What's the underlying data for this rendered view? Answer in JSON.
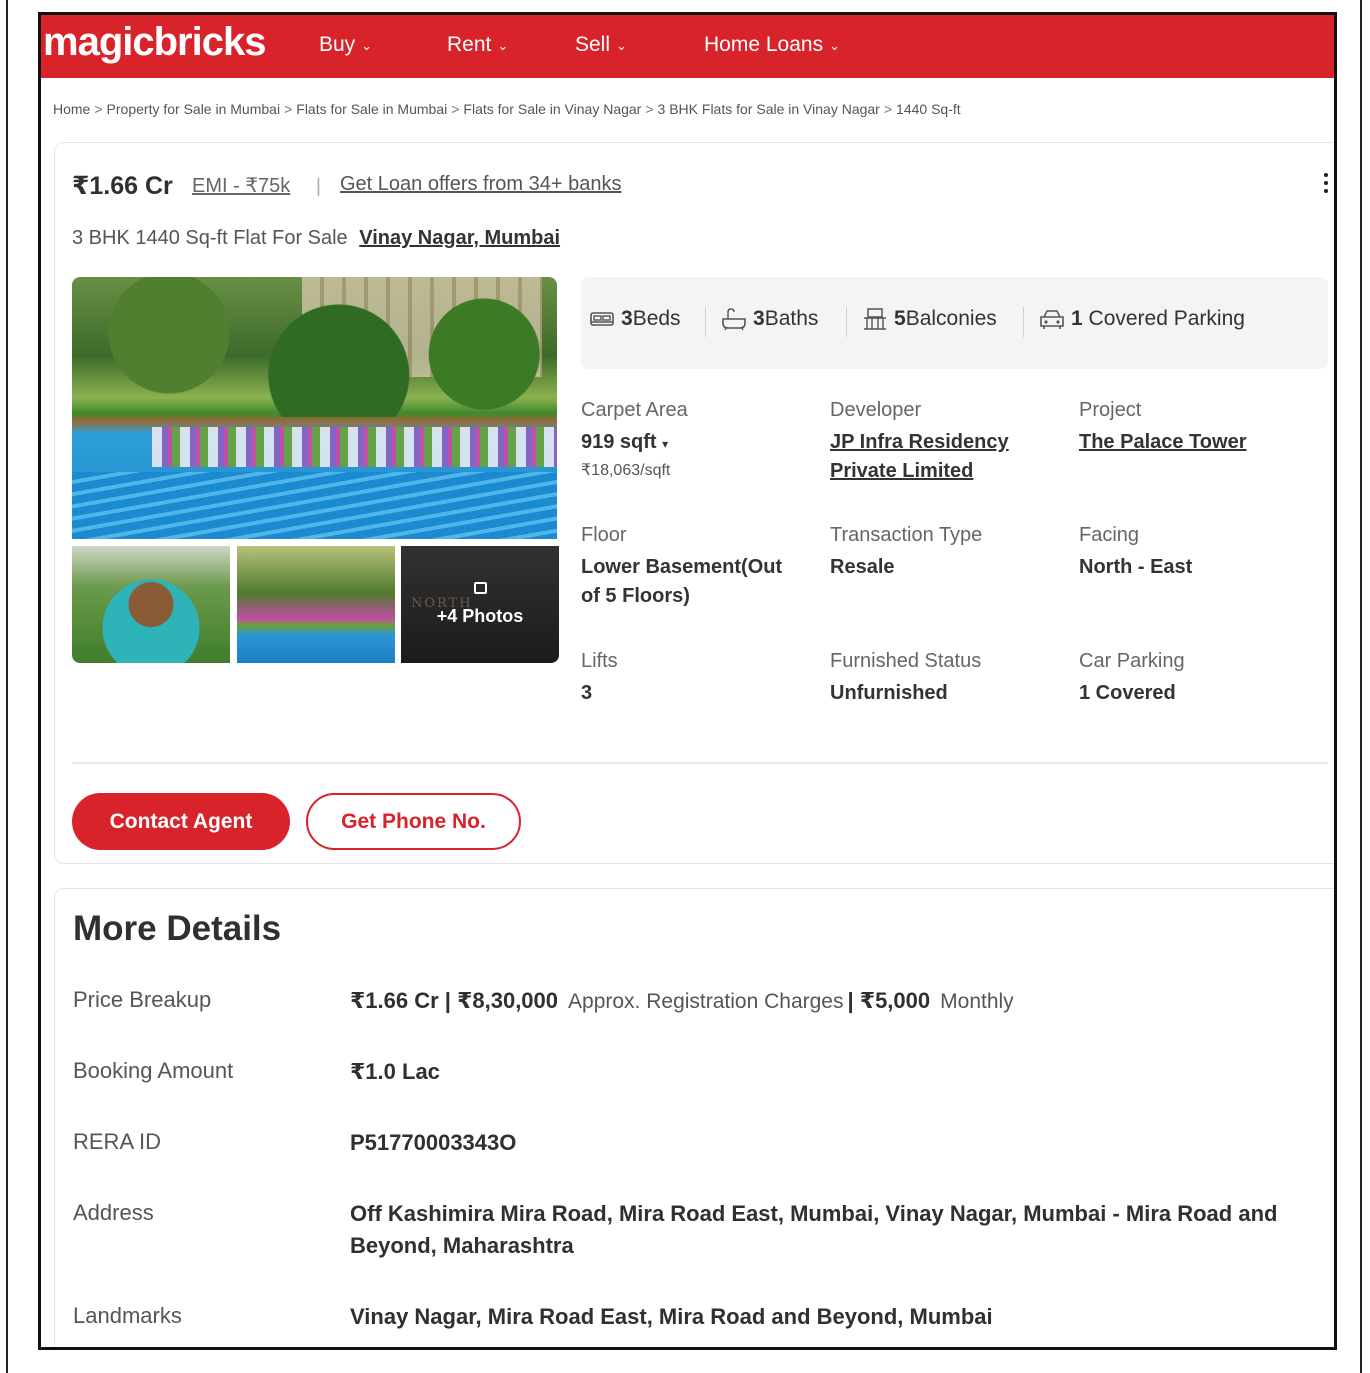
{
  "header": {
    "logo": "magicbricks",
    "nav": [
      {
        "label": "Buy"
      },
      {
        "label": "Rent"
      },
      {
        "label": "Sell"
      },
      {
        "label": "Home Loans"
      }
    ]
  },
  "breadcrumb": [
    "Home",
    "Property for Sale in Mumbai",
    "Flats for Sale in Mumbai",
    "Flats for Sale in Vinay Nagar",
    "3 BHK Flats for Sale in Vinay Nagar",
    "1440 Sq-ft"
  ],
  "listing": {
    "price": "₹1.66 Cr",
    "emi": "EMI - ₹75k",
    "separator": "|",
    "loan_link": "Get Loan offers from 34+ banks",
    "title": "3 BHK 1440 Sq-ft Flat For Sale",
    "locality": "Vinay Nagar, Mumbai",
    "photos_more": "+4 Photos",
    "thumb_watermark": "NORTH",
    "amenities": {
      "beds_num": "3",
      "beds_label": "Beds",
      "baths_num": "3",
      "baths_label": "Baths",
      "balconies_num": "5",
      "balconies_label": "Balconies",
      "parking_num": "1",
      "parking_label": "Covered Parking"
    },
    "details": {
      "carpet_area_label": "Carpet Area",
      "carpet_area_value": "919 sqft",
      "carpet_area_rate": "₹18,063/sqft",
      "developer_label": "Developer",
      "developer_line1": "JP Infra Residency",
      "developer_line2": "Private Limited",
      "project_label": "Project",
      "project_value": "The Palace Tower",
      "floor_label": "Floor",
      "floor_line1": "Lower Basement(Out",
      "floor_line2": "of 5 Floors)",
      "transaction_label": "Transaction Type",
      "transaction_value": "Resale",
      "facing_label": "Facing",
      "facing_value": "North - East",
      "lifts_label": "Lifts",
      "lifts_value": "3",
      "furnished_label": "Furnished Status",
      "furnished_value": "Unfurnished",
      "car_parking_label": "Car Parking",
      "car_parking_value": "1 Covered"
    },
    "contact_button": "Contact Agent",
    "phone_button": "Get Phone No."
  },
  "more_details": {
    "heading": "More Details",
    "price_breakup_label": "Price Breakup",
    "price_breakup_price": "₹1.66 Cr | ₹8,30,000",
    "price_breakup_reg": "Approx. Registration Charges",
    "price_breakup_maint": "| ₹5,000",
    "price_breakup_period": "Monthly",
    "booking_label": "Booking Amount",
    "booking_value": "₹1.0 Lac",
    "rera_label": "RERA ID",
    "rera_value": "P51770003343O",
    "address_label": "Address",
    "address_value": "Off Kashimira Mira Road, Mira Road East, Mumbai, Vinay Nagar, Mumbai - Mira Road and Beyond, Maharashtra",
    "landmarks_label": "Landmarks",
    "landmarks_value": "Vinay Nagar, Mira Road East, Mira Road and Beyond, Mumbai"
  },
  "colors": {
    "brand_red": "#d8232a",
    "text_dark": "#303030",
    "amenity_bg": "#f4f4f4"
  }
}
